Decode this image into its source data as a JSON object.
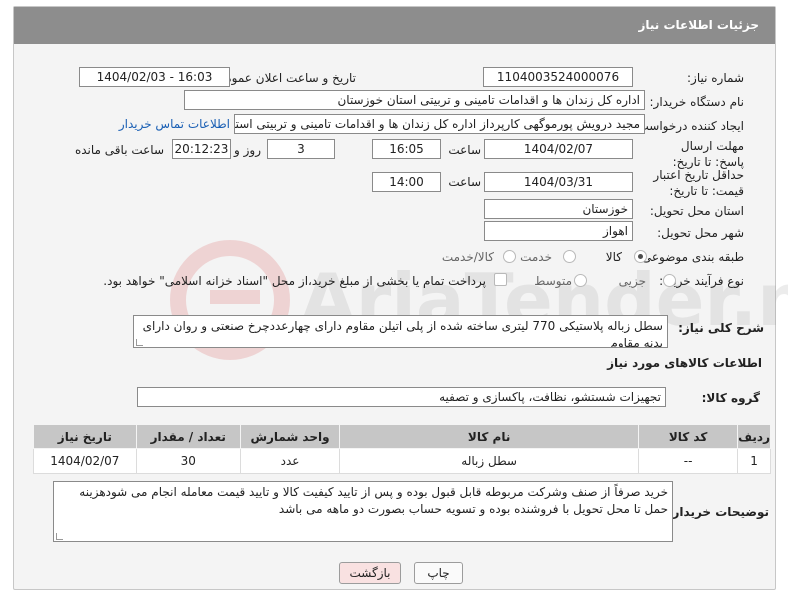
{
  "header": {
    "title": "جزئیات اطلاعات نیاز"
  },
  "fields": {
    "need_number_label": "شماره نیاز:",
    "need_number": "1104003524000076",
    "announce_label": "تاریخ و ساعت اعلان عمومی:",
    "announce_value": "1404/02/03 - 16:03",
    "buyer_org_label": "نام دستگاه خریدار:",
    "buyer_org": "اداره کل زندان ها و اقدامات تامینی و تربیتی استان خوزستان",
    "creator_label": "ایجاد کننده درخواست:",
    "creator": "مجید درویش پورموگهی کارپرداز اداره کل زندان ها و اقدامات تامینی و تربیتی استا",
    "contact_link": "اطلاعات تماس خریدار",
    "deadline_label": "مهلت ارسال پاسخ: تا تاریخ:",
    "deadline_date": "1404/02/07",
    "time_label": "ساعت",
    "deadline_time": "16:05",
    "days_value": "3",
    "days_label": "روز و",
    "remaining_time": "20:12:23",
    "remaining_label": "ساعت باقی مانده",
    "validity_label": "حداقل تاریخ اعتبار قیمت: تا تاریخ:",
    "validity_date": "1404/03/31",
    "validity_time": "14:00",
    "province_label": "استان محل تحویل:",
    "province": "خوزستان",
    "city_label": "شهر محل تحویل:",
    "city": "اهواز",
    "category_label": "طبقه بندی موضوعی:",
    "category_options": [
      "کالا",
      "خدمت",
      "کالا/خدمت"
    ],
    "purchase_label": "نوع فرآیند خرید :",
    "purchase_options": [
      "جزیی",
      "متوسط"
    ],
    "payment_note": "پرداخت تمام یا بخشی از مبلغ خرید،از محل \"اسناد خزانه اسلامی\" خواهد بود."
  },
  "summary": {
    "label": "شرح کلی نیاز:",
    "text": "سطل زباله پلاستیکی 770 لیتری ساخته شده از پلی اتیلن مقاوم دارای چهارعددچرخ صنعتی و روان دارای بدنه مقاوم"
  },
  "goods": {
    "section_title": "اطلاعات کالاهای مورد نیاز",
    "group_label": "گروه کالا:",
    "group_value": "تجهیزات شستشو، نظافت، پاکسازی و تصفیه",
    "columns": [
      "ردیف",
      "کد کالا",
      "نام کالا",
      "واحد شمارش",
      "تعداد / مقدار",
      "تاریخ نیاز"
    ],
    "rows": [
      {
        "row": "1",
        "code": "--",
        "name": "سطل زباله",
        "unit": "عدد",
        "qty": "30",
        "date": "1404/02/07"
      }
    ]
  },
  "notes": {
    "label": "توضیحات خریدار:",
    "text": "خرید صرفاً از صنف وشرکت مربوطه قابل قبول بوده و پس از تایید کیفیت کالا و تایید قیمت معامله انجام می شودهزینه حمل تا محل تحویل با فروشنده بوده و تسویه حساب بصورت دو ماهه می باشد"
  },
  "buttons": {
    "print": "چاپ",
    "back": "بازگشت"
  },
  "colors": {
    "header_bg": "#8d8d8d",
    "panel_bg": "#f4f4f4",
    "link": "#1a5fb4",
    "back_btn_bg": "#f9e1e1"
  }
}
